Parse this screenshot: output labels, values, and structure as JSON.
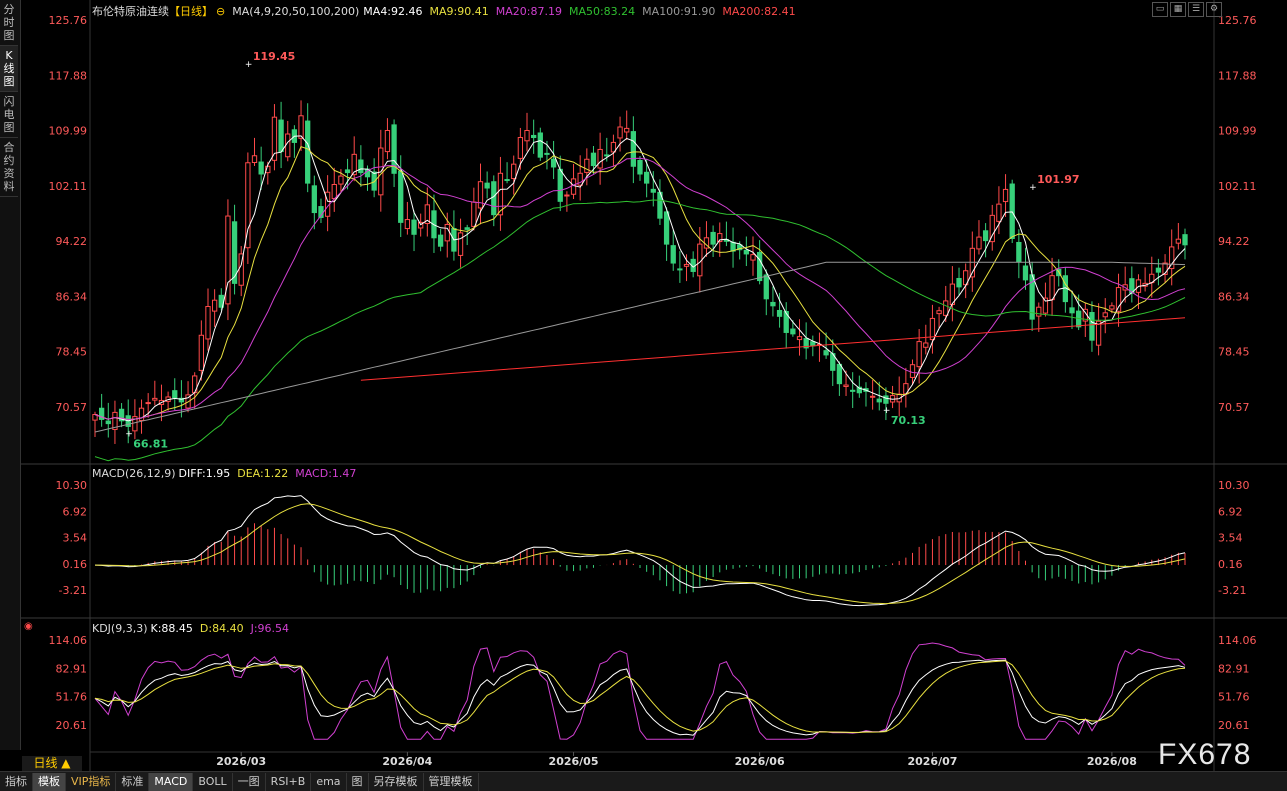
{
  "sidebar": {
    "tabs": [
      {
        "label": "分时图",
        "active": false
      },
      {
        "label": "K线图",
        "active": true
      },
      {
        "label": "闪电图",
        "active": false
      },
      {
        "label": "合约资料",
        "active": false
      }
    ]
  },
  "header": {
    "title": "布伦特原油连续",
    "period": "【日线】",
    "ma_label": "MA(4,9,20,50,100,200)",
    "ma4": "MA4:92.46",
    "ma9": "MA9:90.41",
    "ma20": "MA20:87.19",
    "ma50": "MA50:83.24",
    "ma100": "MA100:91.90",
    "ma200": "MA200:82.41"
  },
  "top_icons": [
    "window-min-icon",
    "grid-icon",
    "list-icon",
    "settings-icon"
  ],
  "price_axis": {
    "ticks": [
      "125.76",
      "117.88",
      "109.99",
      "102.11",
      "94.22",
      "86.34",
      "78.45",
      "70.57"
    ]
  },
  "annotations": {
    "high1": "119.45",
    "low1": "66.81",
    "high2": "101.97",
    "low2": "70.13"
  },
  "macd": {
    "label": "MACD(26,12,9)",
    "diff": "DIFF:1.95",
    "dea": "DEA:1.22",
    "macd": "MACD:1.47",
    "ticks": [
      "10.30",
      "6.92",
      "3.54",
      "0.16",
      "-3.21"
    ]
  },
  "kdj": {
    "label": "KDJ(9,3,3)",
    "k": "K:88.45",
    "d": "D:84.40",
    "j": "J:96.54",
    "ticks": [
      "114.06",
      "82.91",
      "51.76",
      "20.61"
    ]
  },
  "date_axis": [
    "2026/03",
    "2026/04",
    "2026/05",
    "2026/06",
    "2026/07",
    "2026/08"
  ],
  "period_button": "日线 ▲",
  "bottom_tabs": [
    {
      "label": "指标",
      "active": false,
      "vip": false
    },
    {
      "label": "模板",
      "active": true,
      "vip": false
    },
    {
      "label": "VIP指标",
      "active": false,
      "vip": true
    },
    {
      "label": "标准",
      "active": false,
      "vip": false
    },
    {
      "label": "MACD",
      "active": true,
      "vip": false
    },
    {
      "label": "BOLL",
      "active": false,
      "vip": false
    },
    {
      "label": "一图",
      "active": false,
      "vip": false
    },
    {
      "label": "RSI+B",
      "active": false,
      "vip": false
    },
    {
      "label": "ema",
      "active": false,
      "vip": false
    },
    {
      "label": "图",
      "active": false,
      "vip": false
    },
    {
      "label": "另存模板",
      "active": false,
      "vip": false
    },
    {
      "label": "管理模板",
      "active": false,
      "vip": false
    }
  ],
  "watermark": "FX678",
  "colors": {
    "up": "#ff4a4a",
    "down": "#37d07a",
    "ma4": "#ffffff",
    "ma9": "#e8e040",
    "ma20": "#d040d0",
    "ma50": "#30c030",
    "ma100": "#999999",
    "ma200": "#ff3030"
  },
  "chart_data": {
    "type": "candlestick",
    "closes": [
      69.5,
      68.8,
      68.2,
      69.8,
      68.6,
      67.8,
      69.2,
      70.4,
      71.2,
      71.8,
      71.5,
      72.0,
      71.9,
      71.3,
      72.3,
      75.0,
      80.8,
      84.9,
      85.8,
      84.8,
      97.8,
      88.2,
      92.4,
      105.4,
      106.4,
      103.8,
      104.9,
      111.9,
      107.0,
      109.5,
      108.3,
      112.1,
      102.5,
      98.3,
      97.6,
      101.2,
      102.3,
      103.5,
      104.0,
      106.6,
      104.0,
      103.4,
      101.5,
      107.5,
      110.0,
      103.9,
      96.9,
      97.3,
      95.2,
      96.9,
      99.4,
      94.7,
      93.5,
      96.6,
      92.8,
      95.4,
      95.9,
      99.8,
      102.7,
      101.8,
      98.0,
      103.9,
      102.9,
      105.2,
      109.0,
      110.0,
      109.0,
      106.2,
      106.7,
      104.8,
      99.9,
      100.8,
      103.1,
      103.9,
      105.9,
      105.0,
      107.3,
      106.4,
      108.3,
      110.5,
      110.3,
      104.9,
      103.8,
      102.5,
      101.2,
      97.5,
      93.8,
      91.1,
      90.2,
      90.9,
      89.9,
      93.8,
      94.7,
      93.8,
      95.3,
      94.2,
      92.8,
      93.0,
      92.4,
      92.3,
      88.6,
      86.0,
      85.0,
      83.5,
      81.2,
      81.0,
      80.6,
      79.0,
      79.3,
      79.5,
      78.0,
      75.8,
      73.9,
      73.7,
      72.8,
      72.6,
      72.8,
      72.1,
      71.3,
      71.1,
      72.2,
      72.4,
      73.9,
      76.6,
      79.9,
      79.7,
      83.2,
      84.3,
      85.7,
      88.1,
      87.7,
      90.0,
      93.2,
      94.8,
      94.3,
      97.9,
      99.5,
      101.6,
      94.6,
      91.3,
      88.7,
      83.1,
      84.8,
      86.1,
      89.3,
      89.3,
      85.6,
      84.0,
      82.0,
      84.5,
      80.1,
      82.8,
      84.0,
      85.0,
      87.6,
      88.0,
      86.8,
      88.7,
      88.2,
      89.5,
      89.8,
      91.1,
      93.4,
      94.5,
      93.7
    ]
  }
}
